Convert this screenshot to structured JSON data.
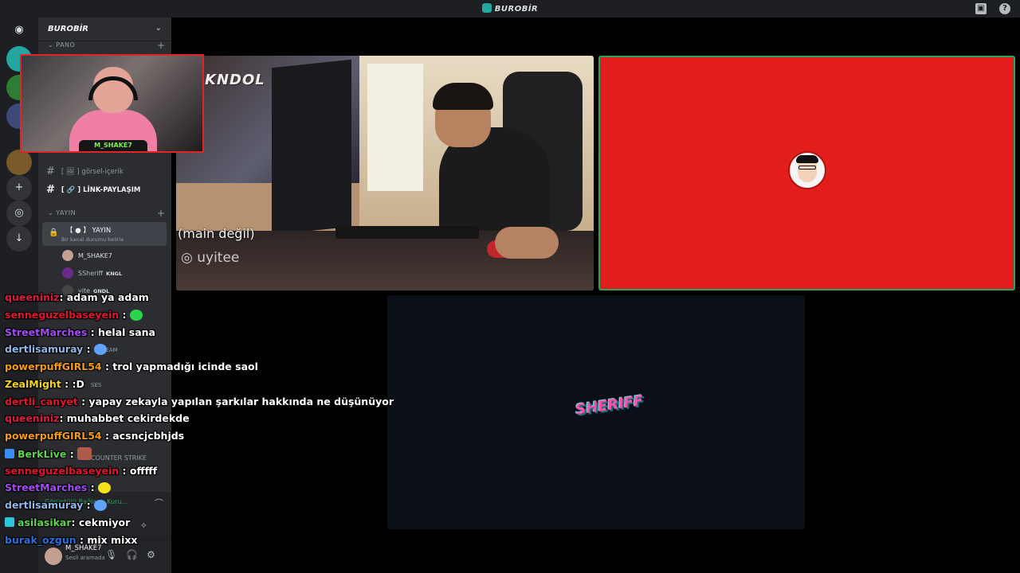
{
  "window": {
    "title": "BUROBİR"
  },
  "server": {
    "name": "BUROBİR"
  },
  "categories": {
    "pano": "PANO",
    "yayin": "YAYIN"
  },
  "channels": [
    {
      "name": "[ 🖼 ] görsel-içerik"
    },
    {
      "name": "[ 🔗 ] LİNK-PAYLAŞIM"
    }
  ],
  "voice_channel": {
    "name": "【 ● 】 YAYIN",
    "status": "Bir kanal durumu belirle"
  },
  "voice_users": [
    {
      "name": "M_SHAKE7",
      "tag": ""
    },
    {
      "name": "SSheriff",
      "tag": "KNGL"
    },
    {
      "name": "yite",
      "tag": "GNDL"
    }
  ],
  "background_fragments": {
    "team": "TEAM",
    "ses": "SES",
    "counter_strike": "COUNTER STRIKE"
  },
  "voice_panel": {
    "status": "Görüntülü Bağlantı Kuru..."
  },
  "user": {
    "name": "M_SHAKE7",
    "status": "Sesli aramada"
  },
  "webcam": {
    "name": "M_SHAKE7"
  },
  "stream_tiles": {
    "camera": {
      "logo": "KNDOL",
      "caption": "(main değil)",
      "handle": "uyitee"
    },
    "sheriff": {
      "logo": "SHERIFF"
    }
  },
  "chat": [
    {
      "user": "queeniniz",
      "color": "#e01640",
      "text": ": adam ya adam",
      "badge": ""
    },
    {
      "user": "senneguzelbaseyein",
      "color": "#e0142a",
      "text": " : ",
      "emote": "#2ad54a",
      "badge": ""
    },
    {
      "user": "StreetMarches",
      "color": "#a44bf5",
      "text": " : helal sana",
      "badge": ""
    },
    {
      "user": "dertlisamuray",
      "color": "#8fb8e8",
      "text": " : ",
      "emote": "#5fa2ff",
      "badge": ""
    },
    {
      "user": "powerpuffGIRL54",
      "color": "#f59a15",
      "text": " : trol yapmadığı icinde saol",
      "badge": ""
    },
    {
      "user": "ZealMight",
      "color": "#f5d31a",
      "text": " : :D",
      "badge": ""
    },
    {
      "user": "dertli_canyet",
      "color": "#e0142a",
      "text": " : yapay zekayla yapılan şarkılar hakkında ne düşünüyor",
      "badge": ""
    },
    {
      "user": "queeniniz",
      "color": "#e01640",
      "text": ": muhabbet cekirdekde",
      "badge": ""
    },
    {
      "user": "powerpuffGIRL54",
      "color": "#f59a15",
      "text": " : acsncjcbhjds",
      "badge": ""
    },
    {
      "user": "BerkLive",
      "color": "#5dd44a",
      "text": " : ",
      "emote": "#b05a4a",
      "badge": "#3a8ff5"
    },
    {
      "user": "senneguzelbaseyein",
      "color": "#e0142a",
      "text": " : offfff",
      "badge": ""
    },
    {
      "user": "StreetMarches",
      "color": "#a44bf5",
      "text": " : ",
      "emote": "#f5e21a",
      "badge": ""
    },
    {
      "user": "dertlisamuray",
      "color": "#8fb8e8",
      "text": " : ",
      "emote": "#5fa2ff",
      "badge": ""
    },
    {
      "user": "asilasikar",
      "color": "#5dd44a",
      "text": ": cekmiyor",
      "badge": "#2fc4d8"
    },
    {
      "user": "burak_ozgun",
      "color": "#2a6ee0",
      "text": " : mix mixx",
      "badge": ""
    }
  ]
}
